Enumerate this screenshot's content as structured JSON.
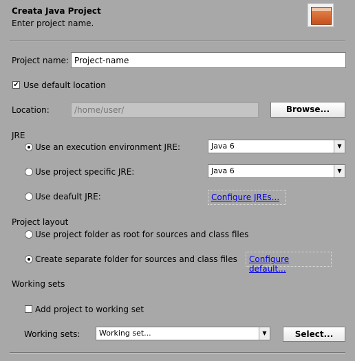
{
  "header": {
    "title": "Creata Java Project",
    "subtitle": "Enter project name.",
    "icon": "wizard-banner-icon"
  },
  "project_name": {
    "label": "Project name:",
    "value": "Project-name"
  },
  "use_default_location": {
    "label": "Use default location",
    "checked": true
  },
  "location": {
    "label": "Location:",
    "value": "/home/user/",
    "browse_label": "Browse..."
  },
  "jre": {
    "group_label": "JRE",
    "options": [
      {
        "label": "Use an execution environment JRE:",
        "selected": true,
        "dropdown": "Java 6"
      },
      {
        "label": "Use project specific JRE:",
        "selected": false,
        "dropdown": "Java 6"
      },
      {
        "label": "Use deafult JRE:",
        "selected": false,
        "link": "Configure JREs..."
      }
    ]
  },
  "project_layout": {
    "group_label": "Project layout",
    "options": [
      {
        "label": "Use project folder as root for sources and class files",
        "selected": false
      },
      {
        "label": "Create separate folder for sources and class files",
        "selected": true,
        "link": "Configure default..."
      }
    ]
  },
  "working_sets": {
    "group_label": "Working sets",
    "add_label": "Add project to working set",
    "add_checked": false,
    "sets_label": "Working sets:",
    "sets_value": "Working set...",
    "select_label": "Select..."
  }
}
